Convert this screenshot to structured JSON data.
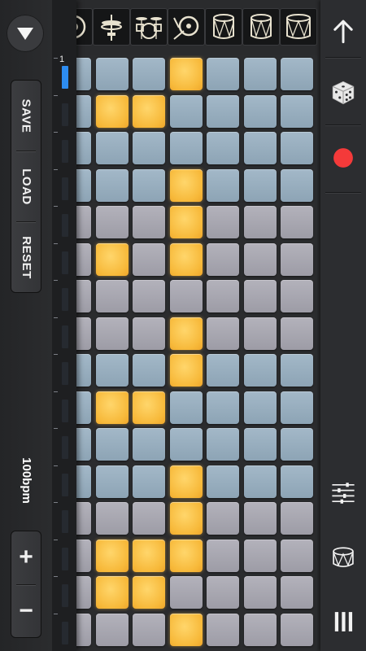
{
  "menu": {
    "collapse_icon": "triangle-down-icon",
    "save_label": "SAVE",
    "load_label": "LOAD",
    "reset_label": "RESET"
  },
  "tempo": {
    "label": "100bpm",
    "increase_label": "+",
    "decrease_label": "−"
  },
  "sequencer": {
    "current_step_label": "1",
    "current_step": 1,
    "instruments": [
      "kick-drum-icon",
      "hi-hat-icon",
      "drum-kit-icon",
      "cymbal-icon",
      "snare-drum-icon",
      "tom-drum-icon",
      "floor-tom-icon"
    ],
    "row_colors": [
      "blue",
      "blue",
      "blue",
      "blue",
      "gray",
      "gray",
      "gray",
      "gray",
      "blue",
      "blue",
      "blue",
      "blue",
      "gray",
      "gray",
      "gray",
      "gray"
    ],
    "pattern": [
      [
        0,
        0,
        0,
        1,
        0,
        0,
        0
      ],
      [
        0,
        1,
        1,
        0,
        0,
        0,
        0
      ],
      [
        0,
        0,
        0,
        0,
        0,
        0,
        0
      ],
      [
        0,
        0,
        0,
        1,
        0,
        0,
        0
      ],
      [
        0,
        0,
        0,
        1,
        0,
        0,
        0
      ],
      [
        0,
        1,
        0,
        1,
        0,
        0,
        0
      ],
      [
        0,
        0,
        0,
        0,
        0,
        0,
        0
      ],
      [
        0,
        0,
        0,
        1,
        0,
        0,
        0
      ],
      [
        0,
        0,
        0,
        1,
        0,
        0,
        0
      ],
      [
        0,
        1,
        1,
        0,
        0,
        0,
        0
      ],
      [
        0,
        0,
        0,
        0,
        0,
        0,
        0
      ],
      [
        0,
        0,
        0,
        1,
        0,
        0,
        0
      ],
      [
        0,
        0,
        0,
        1,
        0,
        0,
        0
      ],
      [
        0,
        1,
        1,
        1,
        0,
        0,
        0
      ],
      [
        0,
        1,
        1,
        0,
        0,
        0,
        0
      ],
      [
        0,
        0,
        0,
        1,
        0,
        0,
        0
      ]
    ]
  },
  "toolbar": {
    "up_icon": "arrow-up-icon",
    "random_icon": "dice-icon",
    "record_icon": "record-icon",
    "mixer_icon": "mixer-sliders-icon",
    "kit_icon": "drum-kit-select-icon",
    "menu_icon": "menu-bars-icon"
  },
  "colors": {
    "pad_on": "#f7b93a",
    "pad_blue": "#98adbe",
    "pad_gray": "#a8a7b0",
    "record": "#f43a3a",
    "step_active": "#2d8cf0"
  }
}
